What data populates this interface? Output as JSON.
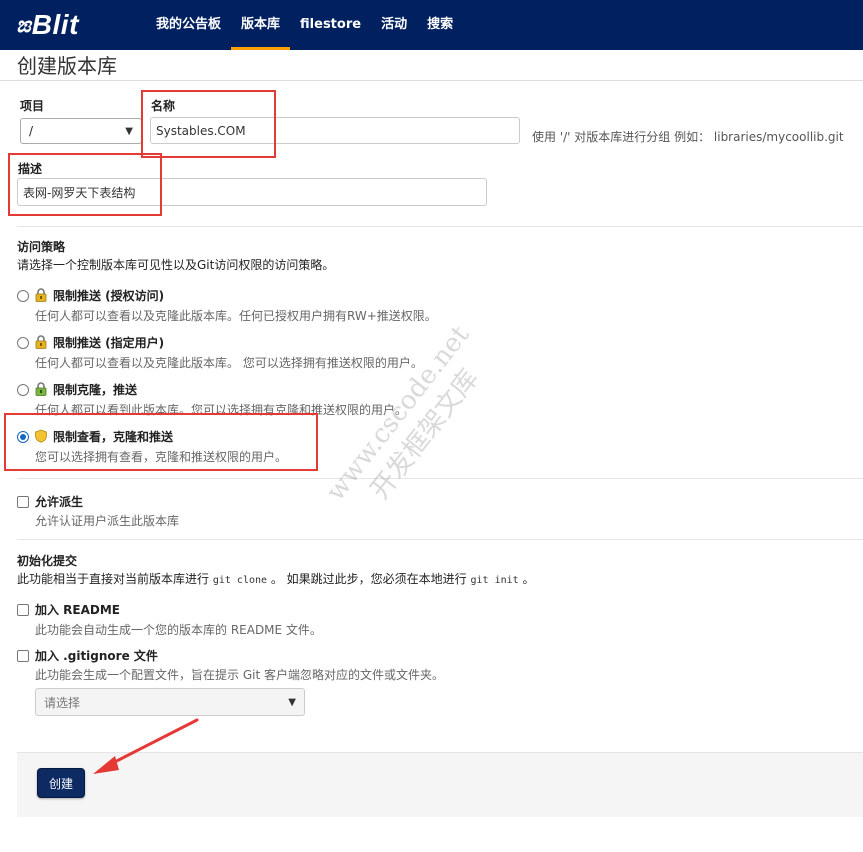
{
  "nav": {
    "logo_mark": "ಙ",
    "logo_text": "Blit",
    "items": [
      "我的公告板",
      "版本库",
      "filestore",
      "活动",
      "搜索"
    ],
    "active": "版本库"
  },
  "page": {
    "title": "创建版本库"
  },
  "form": {
    "project_label": "项目",
    "project_value": "/",
    "name_label": "名称",
    "name_value": "Systables.COM",
    "name_help": "使用 '/' 对版本库进行分组 例如： libraries/mycoollib.git",
    "desc_label": "描述",
    "desc_value": "表网-网罗天下表结构"
  },
  "access": {
    "title": "访问策略",
    "desc": "请选择一个控制版本库可见性以及Git访问权限的访问策略。",
    "options": [
      {
        "label": "限制推送 (授权访问)",
        "desc": "任何人都可以查看以及克隆此版本库。任何已授权用户拥有RW+推送权限。",
        "icon": "lock-icon"
      },
      {
        "label": "限制推送 (指定用户)",
        "desc": "任何人都可以查看以及克隆此版本库。 您可以选择拥有推送权限的用户。",
        "icon": "lock-icon"
      },
      {
        "label": "限制克隆，推送",
        "desc": "任何人都可以看到此版本库。您可以选择拥有克隆和推送权限的用户。",
        "icon": "lock-icon"
      },
      {
        "label": "限制查看，克隆和推送",
        "desc": "您可以选择拥有查看，克隆和推送权限的用户。",
        "icon": "shield-icon"
      }
    ],
    "selected_index": 3
  },
  "fork": {
    "label": "允许派生",
    "desc": "允许认证用户派生此版本库"
  },
  "init": {
    "title": "初始化提交",
    "desc_pre": "此功能相当于直接对当前版本库进行",
    "cmd_clone": "git clone",
    "desc_mid": "。 如果跳过此步，您必须在本地进行",
    "cmd_init": "git init",
    "desc_post": "。",
    "readme_label": "加入 README",
    "readme_desc": "此功能会自动生成一个您的版本库的 README 文件。",
    "gitignore_label": "加入 .gitignore 文件",
    "gitignore_desc": "此功能会生成一个配置文件，旨在提示 Git 客户端忽略对应的文件或文件夹。",
    "gitignore_select": "请选择"
  },
  "actions": {
    "create": "创建"
  },
  "watermark": {
    "line1": "www.cscode.net",
    "line2": "开发框架文库"
  },
  "colors": {
    "navbar": "#002060",
    "active_underline": "#ffa000",
    "annotation_red": "#e53935",
    "button": "#0d2a63"
  }
}
